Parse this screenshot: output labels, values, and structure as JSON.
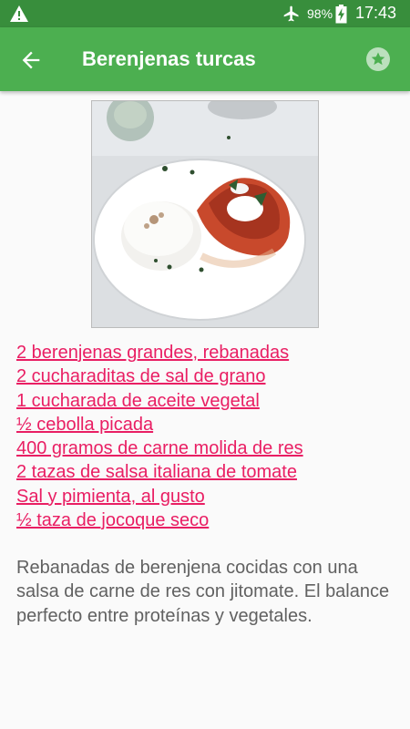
{
  "status_bar": {
    "battery": "98%",
    "time": "17:43",
    "icons": [
      "warning-icon",
      "airplane-mode-icon",
      "battery-charging-icon"
    ]
  },
  "app_bar": {
    "title": "Berenjenas turcas",
    "icons": [
      "arrow-back-icon",
      "star-icon"
    ],
    "color": "#4caf50",
    "status_color": "#388e3c"
  },
  "recipe": {
    "image_alt": "Plato de berenjenas con arroz",
    "ingredients": [
      "2 berenjenas grandes, rebanadas",
      "2 cucharaditas de sal de grano",
      "1 cucharada de aceite vegetal",
      "½ cebolla picada",
      "400 gramos de carne molida de res",
      "2 tazas de salsa italiana de tomate",
      "Sal y pimienta, al gusto",
      "½ taza de jocoque seco"
    ],
    "description": "Rebanadas de berenjena cocidas con una salsa de carne de res con jitomate. El balance perfecto entre proteínas y vegetales.",
    "link_color": "#e91e63",
    "text_color": "#616161"
  }
}
